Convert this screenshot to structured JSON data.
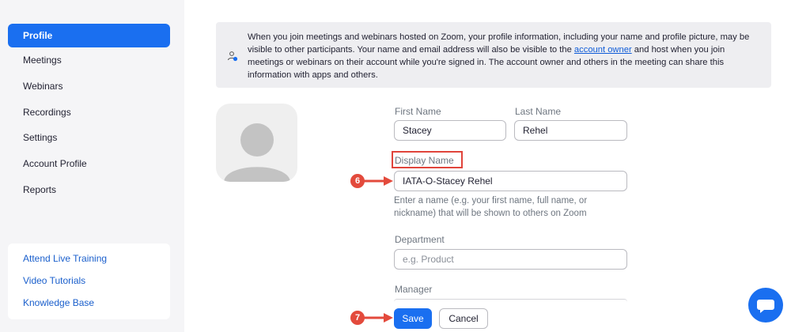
{
  "sidebar": {
    "items": [
      {
        "label": "Profile",
        "active": true
      },
      {
        "label": "Meetings"
      },
      {
        "label": "Webinars"
      },
      {
        "label": "Recordings"
      },
      {
        "label": "Settings"
      },
      {
        "label": "Account Profile"
      },
      {
        "label": "Reports"
      }
    ],
    "help_links": [
      "Attend Live Training",
      "Video Tutorials",
      "Knowledge Base"
    ]
  },
  "notice": {
    "text_before": "When you join meetings and webinars hosted on Zoom, your profile information, including your name and profile picture, may be visible to other participants. Your name and email address will also be visible to the ",
    "link": "account owner",
    "text_after": " and host when you join meetings or webinars on their account while you're signed in. The account owner and others in the meeting can share this information with apps and others."
  },
  "form": {
    "first_name_label": "First Name",
    "first_name_value": "Stacey",
    "last_name_label": "Last Name",
    "last_name_value": "Rehel",
    "display_name_label": "Display Name",
    "display_name_value": "IATA-O-Stacey Rehel",
    "display_name_hint": "Enter a name (e.g. your first name, full name, or nickname) that will be shown to others on Zoom",
    "department_label": "Department",
    "department_placeholder": "e.g. Product",
    "manager_label": "Manager"
  },
  "buttons": {
    "save": "Save",
    "cancel": "Cancel"
  },
  "annotations": {
    "step_display_name": "6",
    "step_save": "7"
  },
  "colors": {
    "accent": "#1a6ff0",
    "annotation": "#e34a3c"
  }
}
